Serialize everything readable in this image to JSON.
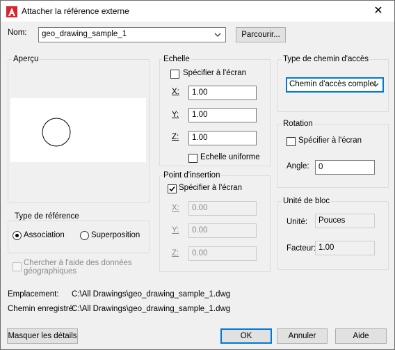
{
  "window": {
    "title": "Attacher la référence externe",
    "close_glyph": "✕"
  },
  "name": {
    "label": "Nom:",
    "value": "geo_drawing_sample_1",
    "browse": "Parcourir..."
  },
  "preview": {
    "label": "Aperçu"
  },
  "scale": {
    "label": "Echelle",
    "specify": "Spécifier à l'écran",
    "x_label": "X:",
    "x_value": "1.00",
    "y_label": "Y:",
    "y_value": "1.00",
    "z_label": "Z:",
    "z_value": "1.00",
    "uniform": "Echelle uniforme"
  },
  "path_type": {
    "label": "Type de chemin d'accès",
    "value": "Chemin d'accès complet"
  },
  "rotation": {
    "label": "Rotation",
    "specify": "Spécifier à l'écran",
    "angle_label": "Angle:",
    "angle_value": "0"
  },
  "insertion": {
    "label": "Point d'insertion",
    "specify": "Spécifier à l'écran",
    "x_label": "X:",
    "x_value": "0.00",
    "y_label": "Y:",
    "y_value": "0.00",
    "z_label": "Z:",
    "z_value": "0.00"
  },
  "ref_type": {
    "label": "Type de référence",
    "attach": "Association",
    "overlay": "Superposition"
  },
  "geo": {
    "line1": "Chercher à l'aide des données",
    "line2": "géographiques"
  },
  "block_unit": {
    "label": "Unité de bloc",
    "unit_label": "Unité:",
    "unit_value": "Pouces",
    "factor_label": "Facteur:",
    "factor_value": "1.00"
  },
  "footer": {
    "location_label": "Emplacement:",
    "location_value": "C:\\All Drawings\\geo_drawing_sample_1.dwg",
    "saved_label": "Chemin enregistré:",
    "saved_value": "C:\\All Drawings\\geo_drawing_sample_1.dwg"
  },
  "buttons": {
    "hide_details": "Masquer les détails",
    "ok": "OK",
    "cancel": "Annuler",
    "help": "Aide"
  },
  "colors": {
    "accent": "#0078d7",
    "app_icon": "#d9232d"
  }
}
